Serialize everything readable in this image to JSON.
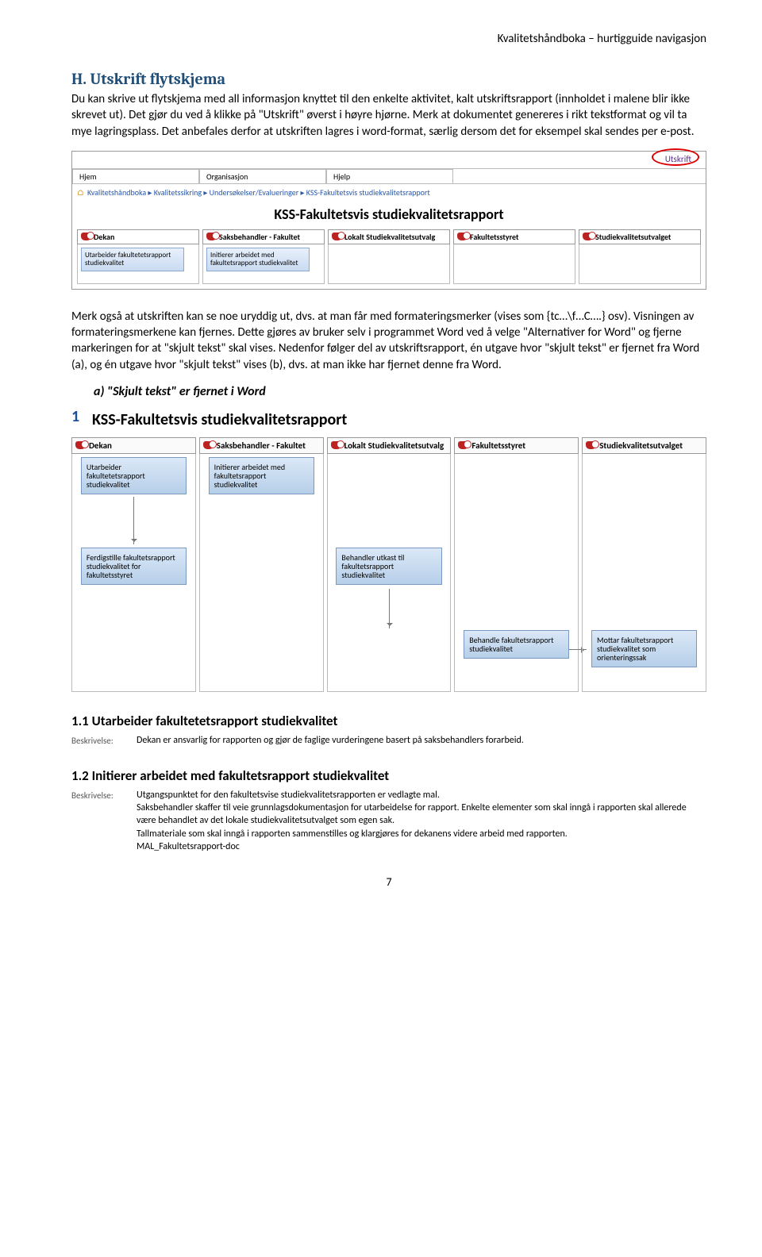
{
  "header": "Kvalitetshåndboka – hurtigguide navigasjon",
  "section_letter": "H.",
  "section_title": "Utskrift flytskjema",
  "para1": "Du kan skrive ut flytskjema med all informasjon knyttet til den enkelte aktivitet, kalt utskriftsrapport (innholdet i malene blir ikke skrevet ut). Det gjør du ved å klikke på \"Utskrift\" øverst i høyre hjørne. Merk at dokumentet genereres i rikt tekstformat og vil ta mye lagringsplass. Det anbefales derfor at utskriften lagres i word-format, særlig dersom det for eksempel skal sendes per e-post.",
  "ui": {
    "utskrift": "Utskrift",
    "tabs": [
      "Hjem",
      "Organisasjon",
      "Hjelp"
    ],
    "breadcrumb": [
      "Kvalitetshåndboka",
      "Kvalitetssikring",
      "Undersøkelser/Evalueringer",
      "KSS-Fakultetsvis studiekvalitetsrapport"
    ],
    "title": "KSS-Fakultetsvis studiekvalitetsrapport",
    "lanes": [
      {
        "head": "Dekan",
        "box": "Utarbeider fakultetetsrapport studiekvalitet"
      },
      {
        "head": "Saksbehandler - Fakultet",
        "box": "Initierer arbeidet med fakultetsrapport studiekvalitet"
      },
      {
        "head": "Lokalt Studiekvalitetsutvalg",
        "box": null
      },
      {
        "head": "Fakultetsstyret",
        "box": null
      },
      {
        "head": "Studiekvalitetsutvalget",
        "box": null
      }
    ]
  },
  "para2": "Merk også at utskriften kan se noe uryddig ut, dvs. at man får med formateringsmerker (vises som {tc…\\f…C….} osv). Visningen av formateringsmerkene kan fjernes. Dette gjøres av bruker selv i programmet Word ved å velge \"Alternativer for Word\" og fjerne markeringen for at \"skjult tekst\" skal vises. Nedenfor følger del av utskriftsrapport, én utgave hvor \"skjult tekst\" er fjernet fra Word (a), og én utgave hvor \"skjult tekst\" vises (b), dvs. at man ikke har fjernet denne fra Word.",
  "option_a": "a)   \"Skjult tekst\" er fjernet i Word",
  "print": {
    "num": "1",
    "title": "KSS-Fakultetsvis studiekvalitetsrapport",
    "lanes": [
      "Dekan",
      "Saksbehandler - Fakultet",
      "Lokalt Studiekvalitetsutvalg",
      "Fakultetsstyret",
      "Studiekvalitetsutvalget"
    ],
    "boxes": {
      "b_dekan1": "Utarbeider fakultetetsrapport studiekvalitet",
      "b_saks1": "Initierer arbeidet med fakultetsrapport studiekvalitet",
      "b_dekan2": "Ferdigstille fakultetsrapport studiekvalitet for fakultetsstyret",
      "b_lokalt": "Behandler utkast til fakultetsrapport studiekvalitet",
      "b_fak": "Behandle fakultetsrapport studiekvalitet",
      "b_sku": "Mottar fakultetsrapport studiekvalitet som orienteringssak"
    }
  },
  "sub1": {
    "title": "1.1 Utarbeider fakultetetsrapport studiekvalitet",
    "label": "Beskrivelse:",
    "text": "Dekan er ansvarlig for rapporten og gjør de faglige vurderingene basert på saksbehandlers forarbeid."
  },
  "sub2": {
    "title": "1.2 Initierer arbeidet med fakultetsrapport studiekvalitet",
    "label": "Beskrivelse:",
    "text1": "Utgangspunktet for den fakultetsvise studiekvalitetsrapporten er vedlagte mal.",
    "text2": "Saksbehandler skaffer til veie grunnlagsdokumentasjon for utarbeidelse for rapport. Enkelte elementer som skal inngå i rapporten skal allerede være behandlet av det lokale studiekvalitetsutvalget som egen sak.",
    "text3": "Tallmateriale som skal inngå i rapporten sammenstilles og klargjøres for dekanens videre arbeid med rapporten.",
    "text4": "MAL_Fakultetsrapport-doc"
  },
  "page_num": "7"
}
